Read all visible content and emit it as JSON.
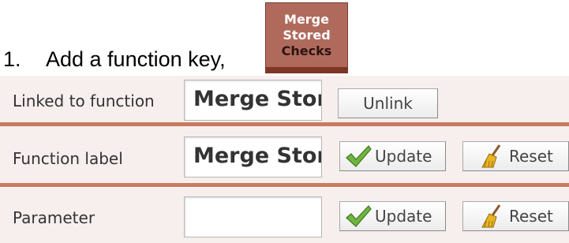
{
  "instruction": {
    "number": "1.",
    "text": "Add a function key,"
  },
  "function_key": {
    "lines": [
      "Merge",
      "Stored",
      "Checks"
    ],
    "color": "#b06a5c",
    "bar_color": "#7d3626"
  },
  "rows": {
    "linked": {
      "label": "Linked to function",
      "value": "Merge Stored Checks",
      "unlink_label": "Unlink"
    },
    "function_label": {
      "label": "Function label",
      "value": "Merge Stored Checks",
      "update_label": "Update",
      "reset_label": "Reset"
    },
    "parameter": {
      "label": "Parameter",
      "value": "",
      "update_label": "Update",
      "reset_label": "Reset"
    }
  },
  "icons": {
    "update": "checkmark-icon",
    "reset": "broom-icon"
  },
  "colors": {
    "row_background": "#f7eeee",
    "row_divider": "#c87a60",
    "checkmark": "#6fb43f"
  }
}
